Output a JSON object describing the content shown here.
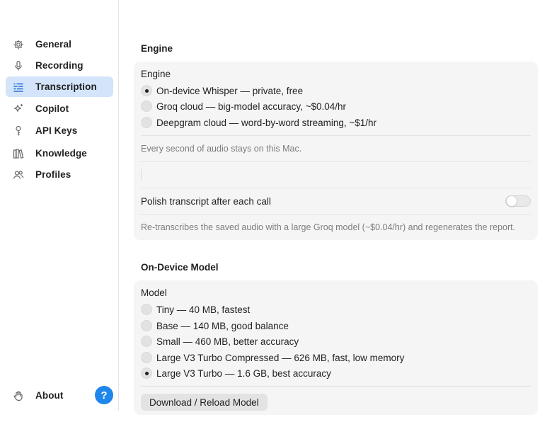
{
  "sidebar": {
    "items": [
      {
        "label": "General",
        "icon": "gear-icon"
      },
      {
        "label": "Recording",
        "icon": "microphone-icon"
      },
      {
        "label": "Transcription",
        "icon": "transcript-lines-icon",
        "active": true
      },
      {
        "label": "Copilot",
        "icon": "sparkle-icon"
      },
      {
        "label": "API Keys",
        "icon": "key-icon"
      },
      {
        "label": "Knowledge",
        "icon": "books-icon"
      },
      {
        "label": "Profiles",
        "icon": "people-icon"
      }
    ],
    "about": {
      "label": "About",
      "icon": "hand-wave-icon"
    },
    "help_label": "?"
  },
  "engine_section": {
    "title": "Engine",
    "card_title": "Engine",
    "options": [
      {
        "label": "On-device Whisper — private, free",
        "selected": true
      },
      {
        "label": "Groq cloud — big-model accuracy, ~$0.04/hr",
        "selected": false
      },
      {
        "label": "Deepgram cloud — word-by-word streaming, ~$1/hr",
        "selected": false
      }
    ],
    "note": "Every second of audio stays on this Mac.",
    "polish_label": "Polish transcript after each call",
    "polish_enabled": false,
    "polish_note": "Re-transcribes the saved audio with a large Groq model (~$0.04/hr) and regenerates the report."
  },
  "model_section": {
    "title": "On-Device Model",
    "card_title": "Model",
    "options": [
      {
        "label": "Tiny — 40 MB, fastest",
        "selected": false
      },
      {
        "label": "Base — 140 MB, good balance",
        "selected": false
      },
      {
        "label": "Small — 460 MB, better accuracy",
        "selected": false
      },
      {
        "label": "Large V3 Turbo Compressed — 626 MB, fast, low memory",
        "selected": false
      },
      {
        "label": "Large V3 Turbo — 1.6 GB, best accuracy",
        "selected": true
      }
    ],
    "button_label": "Download / Reload Model"
  },
  "colors": {
    "accent": "#1f87ec",
    "active_bg": "#d3e4fb",
    "card_bg": "#f5f5f5"
  }
}
